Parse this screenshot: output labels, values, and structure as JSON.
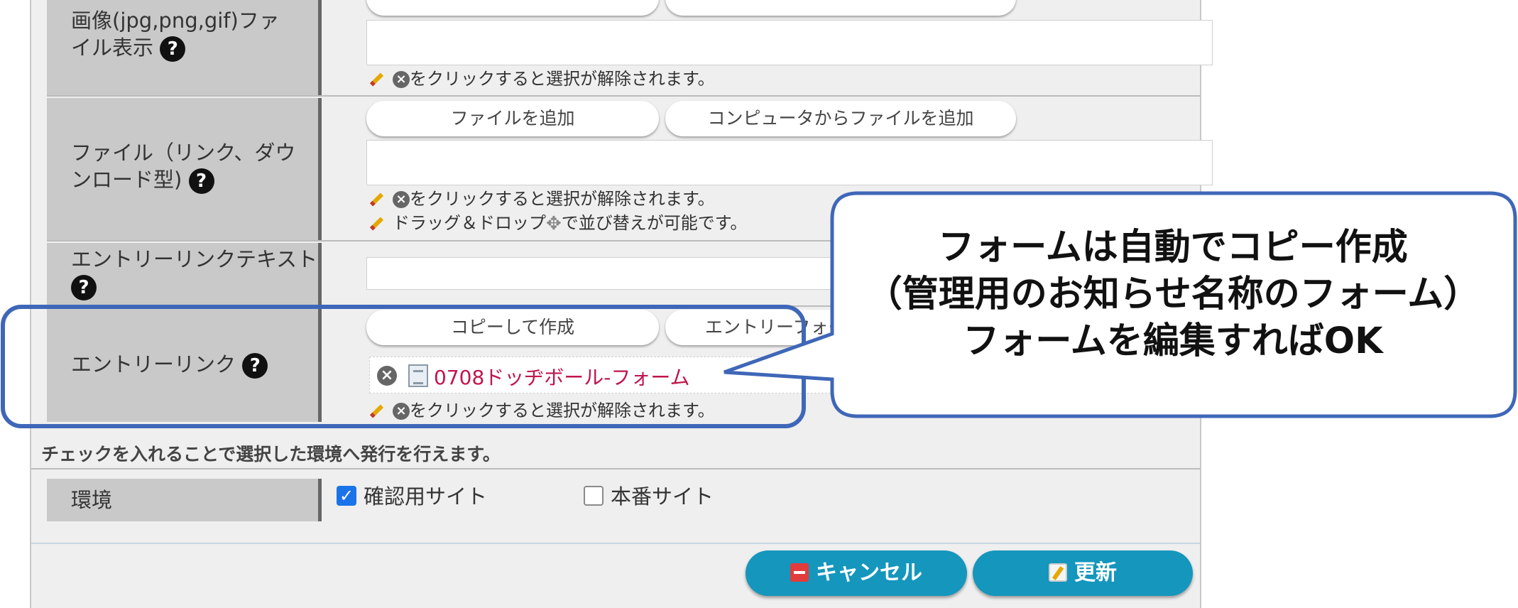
{
  "rows": [
    {
      "label": "画像(jpg,png,gif)ファイル表示"
    },
    {
      "label": "ファイル（リンク、ダウンロード型)",
      "buttons": [
        "ファイルを追加",
        "コンピュータからファイルを追加"
      ]
    },
    {
      "label": "エントリーリンクテキスト"
    },
    {
      "label": "エントリーリンク",
      "buttons": [
        "コピーして作成",
        "エントリーフォー"
      ],
      "selected_item": "0708ドッヂボール-フォーム"
    }
  ],
  "note_remove": "をクリックすると選択が解除されます。",
  "note_drag_prefix": "ドラッグ＆ドロップ",
  "note_drag_suffix": "で並び替えが可能です。",
  "publish_notice": "チェックを入れることで選択した環境へ発行を行えます。",
  "environment": {
    "label": "環境",
    "options": [
      {
        "label": "確認用サイト",
        "checked": true
      },
      {
        "label": "本番サイト",
        "checked": false
      }
    ]
  },
  "actions": {
    "cancel": "キャンセル",
    "update": "更新"
  },
  "callout": {
    "lines": [
      "フォームは自動でコピー作成",
      "（管理用のお知らせ名称のフォーム）",
      "フォームを編集すればOK"
    ]
  },
  "colors": {
    "action": "#1596bd",
    "callout_border": "#3f67b8",
    "link": "#c0154a"
  }
}
